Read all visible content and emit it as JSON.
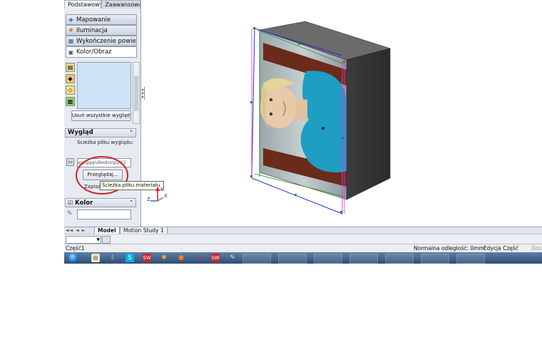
{
  "property_manager": {
    "top_tabs": [
      "Podstawowy",
      "Zaawansowa"
    ],
    "sub_tabs": [
      {
        "label": "Mapowanie",
        "icon": "mapping-icon"
      },
      {
        "label": "Iluminacja",
        "icon": "illumination-icon"
      },
      {
        "label": "Wykończenie powierz...",
        "icon": "surface-finish-icon"
      },
      {
        "label": "Kolor/Obraz",
        "icon": "color-image-icon"
      }
    ],
    "remove_all_button": "Usuń wszystkie wyglądy",
    "appearance_section": {
      "title": "Wygląd",
      "path_label": "Ścieżka pliku wyglądu:",
      "path_value": "ers\\ppp\\deskto\\p223",
      "browse_button": "Przeglądaj...",
      "save_button": "Zapisz",
      "tooltip": "Ścieżka pliku materiału"
    },
    "color_section": {
      "title": "Kolor"
    }
  },
  "bottom_tabs": {
    "active": "Model",
    "items": [
      "Model",
      "Motion Study 1"
    ]
  },
  "status_bar": {
    "left": "Część1",
    "distance": "Normalna odległość: 0mm",
    "mode": "Edycja Część",
    "extra": "Dost"
  },
  "triad": {
    "x": "X",
    "y": "Y",
    "z": "Z"
  },
  "colors": {
    "selection_blue": "#2a2ad0",
    "selection_magenta": "#d63ad6",
    "box_dark": "#3a3a3a",
    "highlight_red": "#d81f26"
  }
}
